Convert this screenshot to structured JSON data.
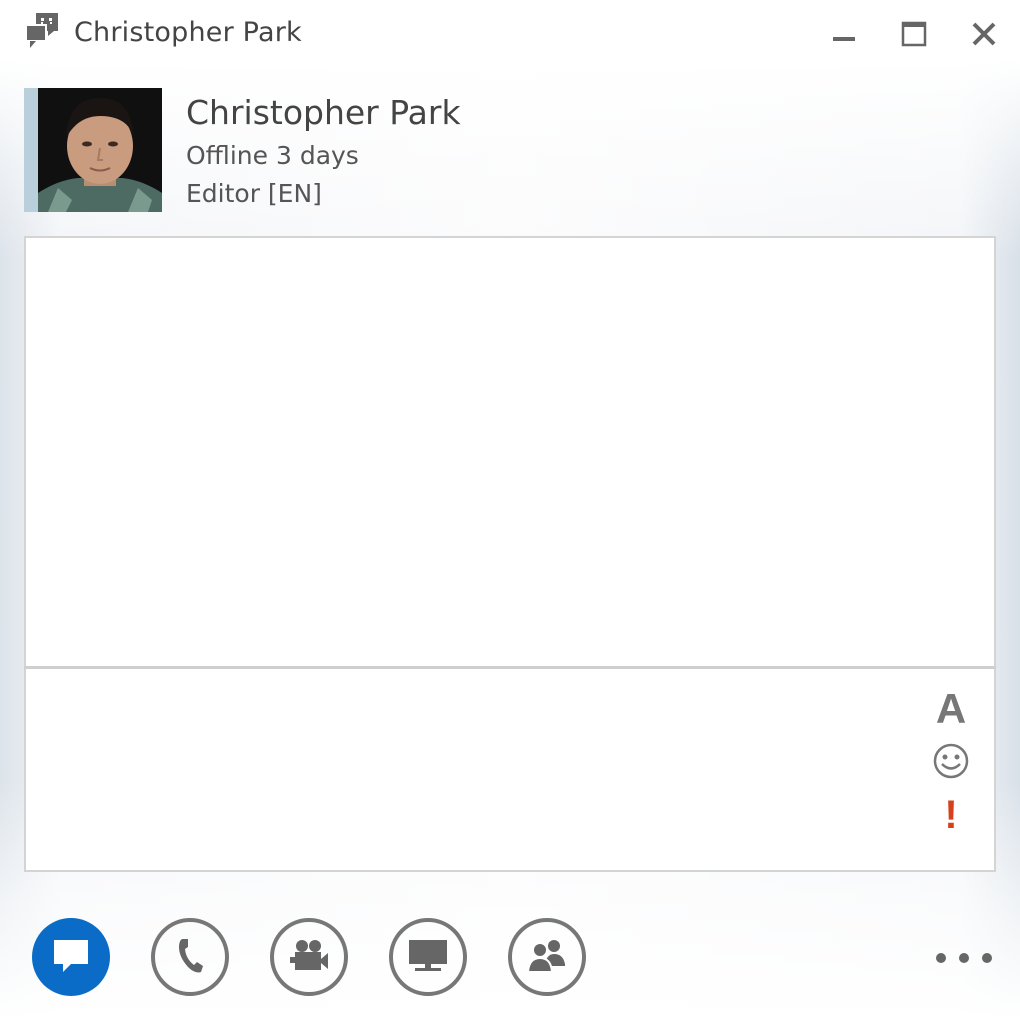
{
  "window": {
    "title": "Christopher Park",
    "title_icon": "im-conversation-icon",
    "controls": {
      "minimize": "minimize-icon",
      "maximize": "maximize-icon",
      "close": "close-icon"
    }
  },
  "contact": {
    "name": "Christopher Park",
    "status": "Offline 3 days",
    "title": "Editor [EN]",
    "presence_color": "#b9cfdc"
  },
  "conversation": {
    "messages": []
  },
  "compose": {
    "value": "",
    "tools": [
      {
        "name": "font",
        "icon": "font-icon",
        "glyph": "A"
      },
      {
        "name": "emoticon",
        "icon": "smiley-icon"
      },
      {
        "name": "high-importance",
        "icon": "exclamation-icon",
        "glyph": "!"
      }
    ]
  },
  "toolbar": {
    "modes": [
      {
        "name": "im",
        "icon": "chat-bubble-icon",
        "active": true
      },
      {
        "name": "call",
        "icon": "phone-icon",
        "active": false
      },
      {
        "name": "video",
        "icon": "video-camera-icon",
        "active": false
      },
      {
        "name": "present",
        "icon": "monitor-icon",
        "active": false
      },
      {
        "name": "participants",
        "icon": "people-icon",
        "active": false
      }
    ],
    "more": "more-options-icon"
  },
  "colors": {
    "accent": "#0a6cc6",
    "important": "#d6401a",
    "icon_gray": "#777777"
  }
}
